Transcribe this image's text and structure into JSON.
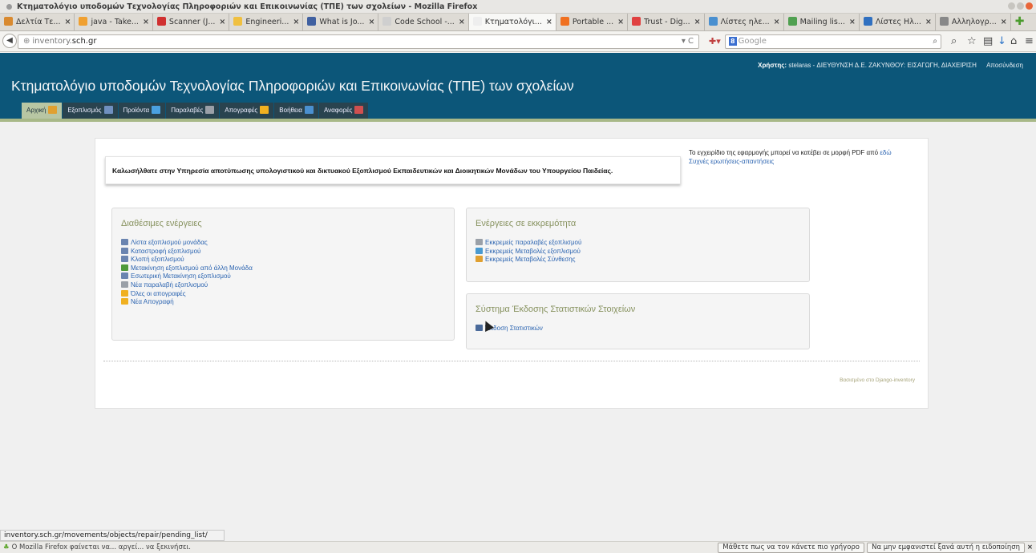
{
  "window": {
    "title": "Κτηματολόγιο υποδομών Τεχνολογίας Πληροφοριών και Επικοινωνίας (ΤΠΕ) των σχολείων - Mozilla Firefox"
  },
  "tabs": [
    {
      "label": "Δελτία Τε...",
      "icon_color": "#d98a30"
    },
    {
      "label": "java - Take...",
      "icon_color": "#f0a030"
    },
    {
      "label": "Scanner (J...",
      "icon_color": "#d03030"
    },
    {
      "label": "Engineeri...",
      "icon_color": "#f0c040"
    },
    {
      "label": "What is Jo...",
      "icon_color": "#4060a0"
    },
    {
      "label": "Code School -...",
      "icon_color": "#cfcfcf"
    },
    {
      "label": "Κτηματολόγι...",
      "icon_color": "#eeeeee",
      "active": true
    },
    {
      "label": "Portable ...",
      "icon_color": "#f07020"
    },
    {
      "label": "Trust - Dig...",
      "icon_color": "#e04040"
    },
    {
      "label": "Λίστες ηλε...",
      "icon_color": "#4a90d0"
    },
    {
      "label": "Mailing lis...",
      "icon_color": "#50a050"
    },
    {
      "label": "Λίστες Ηλ...",
      "icon_color": "#3070c0"
    },
    {
      "label": "Αλληλογρ...",
      "icon_color": "#888888"
    }
  ],
  "nav": {
    "url_host_prefix": "inventory.",
    "url_host": "sch.gr",
    "search_placeholder": "Google",
    "search_engine_badge": "8"
  },
  "header": {
    "user_label": "Χρήστης:",
    "user_value": "stelaras - ΔΙΕΥΘΥΝΣΗ Δ.Ε. ΖΑΚΥΝΘΟΥ: ΕΙΣΑΓΩΓΗ, ΔΙΑΧΕΙΡΙΣΗ",
    "logout": "Αποσύνδεση",
    "site_title": "Κτηματολόγιο υποδομών Τεχνολογίας Πληροφοριών και Επικοινωνίας (ΤΠΕ) των σχολείων"
  },
  "menu": [
    {
      "label": "Αρχική",
      "icon_color": "#e0a030",
      "active": true
    },
    {
      "label": "Εξοπλισμός",
      "icon_color": "#7090c0"
    },
    {
      "label": "Προϊόντα",
      "icon_color": "#4aa0e0"
    },
    {
      "label": "Παραλαβές",
      "icon_color": "#9aa0a8"
    },
    {
      "label": "Απογραφές",
      "icon_color": "#f0b020"
    },
    {
      "label": "Βοήθεια",
      "icon_color": "#4a90d0"
    },
    {
      "label": "Αναφορές",
      "icon_color": "#d05050"
    }
  ],
  "welcome": "Καλωσήλθατε στην Υπηρεσία αποτύπωσης υπολογιστικού και δικτυακού Εξοπλισμού Εκπαιδευτικών και Διοικητικών Μονάδων του Υπουργείου Παιδείας.",
  "manual": {
    "text": "Το εγχειρίδιο της εφαρμογής μπορεί να κατέβει σε μορφή PDF από",
    "link": "εδώ",
    "faq": "Συχνές ερωτήσεις-απαντήσεις"
  },
  "available_actions": {
    "title": "Διαθέσιμες ενέργειες",
    "items": [
      {
        "label": "Λίστα εξοπλισμού μονάδας",
        "icon_color": "#6a84b0"
      },
      {
        "label": "Καταστροφή εξοπλισμού",
        "icon_color": "#6a84b0"
      },
      {
        "label": "Κλοπή εξοπλισμού",
        "icon_color": "#6a84b0"
      },
      {
        "label": "Μετακίνηση εξοπλισμού από άλλη Μονάδα",
        "icon_color": "#4f9a3a"
      },
      {
        "label": "Εσωτερική Μετακίνηση εξοπλισμού",
        "icon_color": "#6a84b0"
      },
      {
        "label": "Νέα παραλαβή εξοπλισμού",
        "icon_color": "#9aa0a8"
      },
      {
        "label": "Όλες οι απογραφές",
        "icon_color": "#f0b020"
      },
      {
        "label": "Νέα Απογραφή",
        "icon_color": "#f0b020"
      }
    ]
  },
  "pending_actions": {
    "title": "Ενέργειες σε εκκρεμότητα",
    "items": [
      {
        "label": "Εκκρεμείς παραλαβές εξοπλισμού",
        "icon_color": "#9aa0a8"
      },
      {
        "label": "Εκκρεμείς Μεταβολές εξοπλισμού",
        "icon_color": "#4a9ad0"
      },
      {
        "label": "Εκκρεμείς Μεταβολές Σύνθεσης",
        "icon_color": "#e0a030"
      }
    ]
  },
  "stats": {
    "title": "Σύστημα Έκδοσης Στατιστικών Στοιχείων",
    "items": [
      {
        "label": "Έκδοση Στατιστικών",
        "icon_color": "#4a6a9a"
      }
    ]
  },
  "footer": {
    "powered": "Βασισμένο στο Django-inventory"
  },
  "statusbar": "inventory.sch.gr/movements/objects/repair/pending_list/",
  "notification": {
    "text": "Ο Mozilla Firefox φαίνεται να... αργεί... να ξεκινήσει.",
    "btn_faster": "Μάθετε πως να τον κάνετε πιο γρήγορο",
    "btn_dontshow": "Να μην εμφανιστεί ξανά αυτή η ειδοποίηση"
  }
}
